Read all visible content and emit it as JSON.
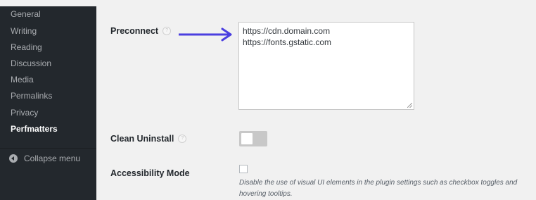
{
  "sidebar": {
    "items": [
      {
        "label": "General"
      },
      {
        "label": "Writing"
      },
      {
        "label": "Reading"
      },
      {
        "label": "Discussion"
      },
      {
        "label": "Media"
      },
      {
        "label": "Permalinks"
      },
      {
        "label": "Privacy"
      },
      {
        "label": "Perfmatters",
        "current": true
      }
    ],
    "collapse_label": "Collapse menu"
  },
  "settings": {
    "preconnect": {
      "label": "Preconnect",
      "help": "?",
      "lines": [
        "https://cdn.domain.com",
        "https://fonts.gstatic.com"
      ]
    },
    "clean_uninstall": {
      "label": "Clean Uninstall",
      "help": "?",
      "enabled": false
    },
    "accessibility_mode": {
      "label": "Accessibility Mode",
      "checked": false,
      "description": "Disable the use of visual UI elements in the plugin settings such as checkbox toggles and hovering tooltips."
    }
  },
  "colors": {
    "sidebar_bg": "#23282d",
    "content_bg": "#f1f1f1",
    "arrow": "#4b3fe0",
    "toggle_off": "#c8c8c8"
  },
  "icons": [
    "help-icon",
    "collapse-icon",
    "arrow-annotation"
  ]
}
